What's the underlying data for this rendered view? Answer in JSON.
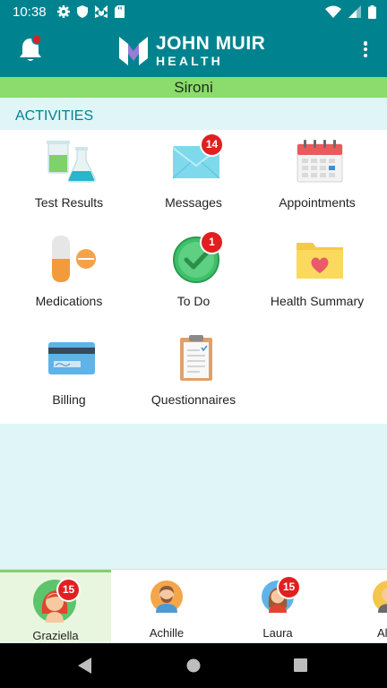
{
  "status_bar": {
    "time": "10:38"
  },
  "app_bar": {
    "logo_line1": "JOHN MUIR",
    "logo_line2": "HEALTH",
    "brand_color": "#00838f"
  },
  "patient_name": "Sironi",
  "section_title": "ACTIVITIES",
  "activities": [
    {
      "label": "Test Results",
      "icon": "test-tubes-icon"
    },
    {
      "label": "Messages",
      "icon": "envelope-icon",
      "badge": "14"
    },
    {
      "label": "Appointments",
      "icon": "calendar-icon"
    },
    {
      "label": "Medications",
      "icon": "pills-icon"
    },
    {
      "label": "To Do",
      "icon": "checkmark-icon",
      "badge": "1"
    },
    {
      "label": "Health Summary",
      "icon": "folder-heart-icon"
    },
    {
      "label": "Billing",
      "icon": "credit-card-icon"
    },
    {
      "label": "Questionnaires",
      "icon": "clipboard-icon"
    }
  ],
  "profiles": [
    {
      "name": "Graziella",
      "badge": "15",
      "active": true
    },
    {
      "name": "Achille"
    },
    {
      "name": "Laura",
      "badge": "15"
    },
    {
      "name": "Albe"
    }
  ]
}
